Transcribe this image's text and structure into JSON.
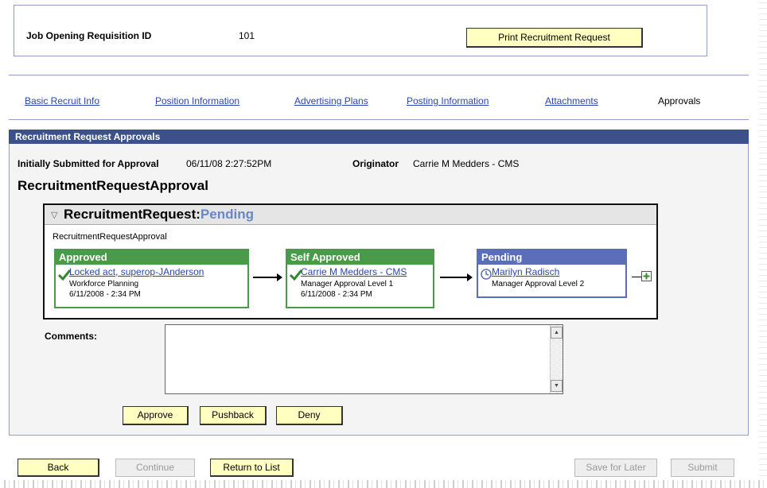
{
  "header": {
    "req_label": "Job Opening Requisition ID",
    "req_value": "101",
    "print_button": "Print Recruitment Request"
  },
  "tabs": [
    {
      "label": "Basic Recruit Info"
    },
    {
      "label": "Position Information"
    },
    {
      "label": "Advertising Plans"
    },
    {
      "label": "Posting Information"
    },
    {
      "label": "Attachments"
    },
    {
      "label": "Approvals"
    }
  ],
  "section": {
    "title": "Recruitment Request Approvals",
    "submitted_label": "Initially Submitted for Approval",
    "submitted_value": "06/11/08  2:27:52PM",
    "originator_label": "Originator",
    "originator_value": "Carrie M Medders - CMS",
    "workflow_name": "RecruitmentRequestApproval"
  },
  "flow": {
    "title_prefix": "RecruitmentRequest:",
    "title_status": "Pending",
    "subtitle": "RecruitmentRequestApproval",
    "steps": [
      {
        "status": "Approved",
        "who": "Locked act, superop-JAnderson",
        "role": "Workforce Planning",
        "time": "6/11/2008 - 2:34 PM"
      },
      {
        "status": "Self Approved",
        "who": "Carrie M Medders - CMS",
        "role": "Manager Approval Level 1",
        "time": "6/11/2008 - 2:34 PM"
      },
      {
        "status": "Pending",
        "who": "Marilyn Radisch",
        "role": "Manager Approval Level 2",
        "time": ""
      }
    ]
  },
  "comments": {
    "label": "Comments:",
    "value": ""
  },
  "action_buttons": {
    "approve": "Approve",
    "pushback": "Pushback",
    "deny": "Deny"
  },
  "footer": {
    "back": "Back",
    "continue": "Continue",
    "return": "Return to List",
    "save_later": "Save for Later",
    "submit": "Submit"
  },
  "colors": {
    "section_header": "#3c5189",
    "approved": "#4b9a4b",
    "pending": "#5a6fb8",
    "button_bg": "#ffffc2",
    "link": "#2a46b0"
  }
}
